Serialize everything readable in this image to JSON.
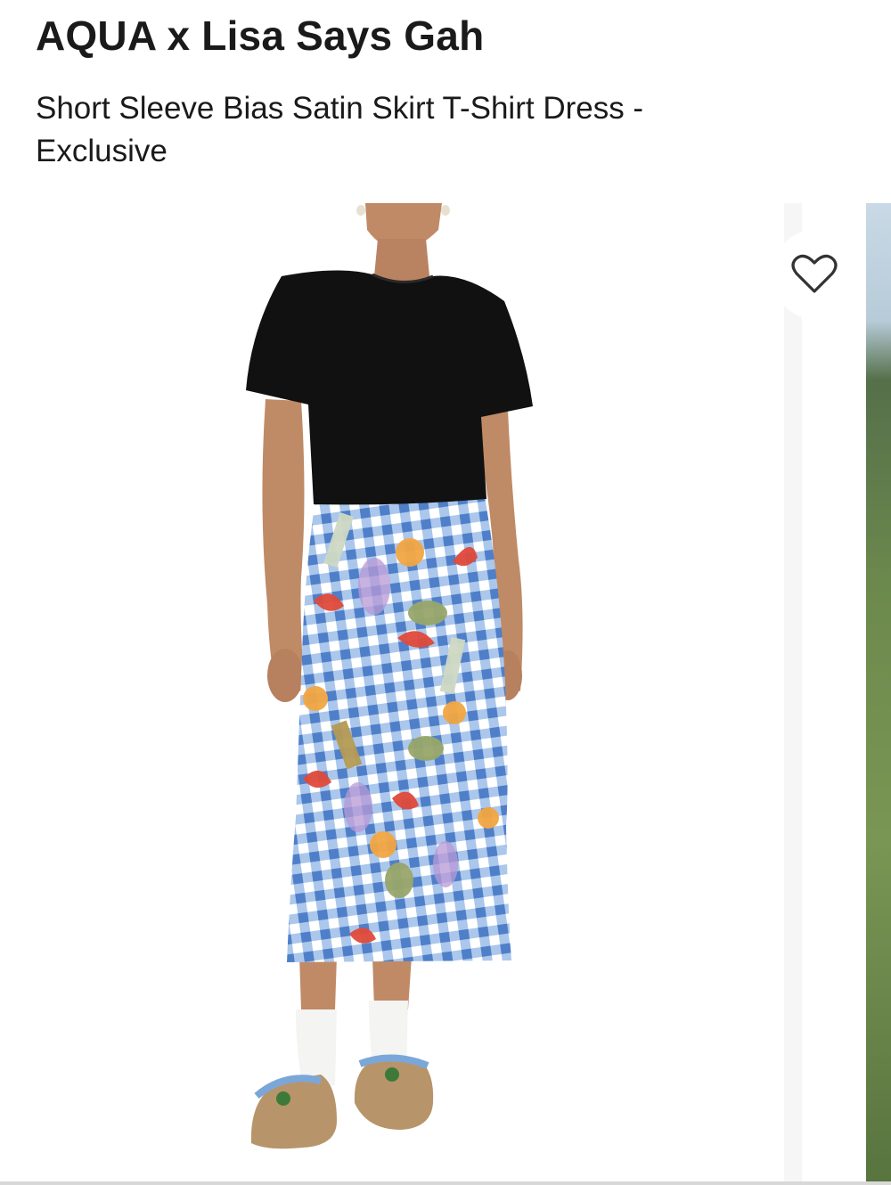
{
  "product": {
    "brand": "AQUA x Lisa Says Gah",
    "name": "Short Sleeve Bias Satin Skirt T-Shirt Dress - Exclusive"
  },
  "gallery": {
    "main_image_icon": "model-wearing-dress-photo",
    "next_image_icon": "outdoor-photo-peek"
  },
  "wishlist": {
    "icon": "heart-outline-icon"
  },
  "colors": {
    "text": "#1a1a1a",
    "shirt": "#111111",
    "skirt_gingham": "#7ea8de",
    "background": "#ffffff"
  }
}
